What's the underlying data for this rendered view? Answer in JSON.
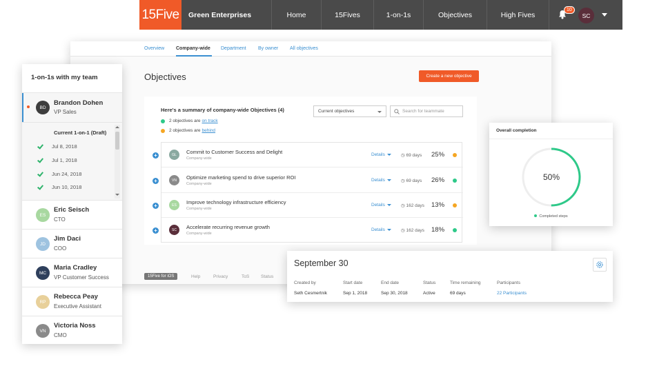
{
  "topnav": {
    "logo": "15Five",
    "org_name": "Green Enterprises",
    "items": [
      "Home",
      "15Fives",
      "1-on-1s",
      "Objectives",
      "High Fives"
    ],
    "notifications": "10",
    "user_initials": "SC"
  },
  "subtabs": [
    "Overview",
    "Company-wide",
    "Department",
    "By owner",
    "All objectives"
  ],
  "objectives": {
    "page_title": "Objectives",
    "create_button": "Create a new objective",
    "summary_title": "Here's a summary of company-wide Objectives (4)",
    "on_track": {
      "prefix": "2 objectives are",
      "link": "on track"
    },
    "behind": {
      "prefix": "2 objectives are",
      "link": "behind"
    },
    "filter_value": "Current objectives",
    "search_placeholder": "Search for teammate",
    "details_label": "Details",
    "rows": [
      {
        "initials": "GL",
        "avatar_color": "#8aa9a0",
        "title": "Commit to Customer Success and Delight",
        "scope": "Company-wide",
        "days": "69 days",
        "percent": "25%",
        "status_color": "#f5a623"
      },
      {
        "initials": "VN",
        "avatar_color": "#8a8a8a",
        "title": "Optimize marketing spend to drive superior ROI",
        "scope": "Company-wide",
        "days": "69 days",
        "percent": "26%",
        "status_color": "#2ec989"
      },
      {
        "initials": "ES",
        "avatar_color": "#a8d8a0",
        "title": "Improve technology infrastructure efficiency",
        "scope": "Company-wide",
        "days": "162 days",
        "percent": "13%",
        "status_color": "#f5a623"
      },
      {
        "initials": "SC",
        "avatar_color": "#5a2e3a",
        "title": "Accelerate recurring revenue growth",
        "scope": "Company-wide",
        "days": "162 days",
        "percent": "18%",
        "status_color": "#2ec989"
      }
    ]
  },
  "footer": {
    "ios": "15Five for iOS",
    "links": [
      "Help",
      "Privacy",
      "ToS",
      "Status"
    ]
  },
  "sidebar": {
    "title": "1-on-1s with my team",
    "current": {
      "initials": "BD",
      "avatar_color": "#3d3d3d",
      "name": "Brandon Dohen",
      "role": "VP Sales"
    },
    "draft_title": "Current 1-on-1 (Draft)",
    "dates": [
      "Jul 8, 2018",
      "Jul 1, 2018",
      "Jun 24, 2018",
      "Jun 10, 2018"
    ],
    "people": [
      {
        "initials": "ES",
        "avatar_color": "#a8d8a0",
        "name": "Eric Seisch",
        "role": "CTO"
      },
      {
        "initials": "JD",
        "avatar_color": "#9ec3e0",
        "name": "Jim Daci",
        "role": "COO"
      },
      {
        "initials": "MC",
        "avatar_color": "#2e3f5c",
        "name": "Maria Cradley",
        "role": "VP Customer Success"
      },
      {
        "initials": "RP",
        "avatar_color": "#e8d09a",
        "name": "Rebecca Peay",
        "role": "Executive Assistant"
      },
      {
        "initials": "VN",
        "avatar_color": "#8a8a8a",
        "name": "Victoria Noss",
        "role": "CMO"
      }
    ]
  },
  "completion": {
    "title": "Overall completion",
    "percent_label": "50%",
    "fraction": 0.5,
    "legend": "Completed steps",
    "color": "#2ec989"
  },
  "period": {
    "title": "September 30",
    "headers": [
      "Created by",
      "Start date",
      "End date",
      "Status",
      "Time remaining",
      "Participants"
    ],
    "values": [
      "Seth Cesmertnik",
      "Sep 1, 2018",
      "Sep 30, 2018",
      "Active",
      "69 days",
      "22 Participants"
    ]
  }
}
